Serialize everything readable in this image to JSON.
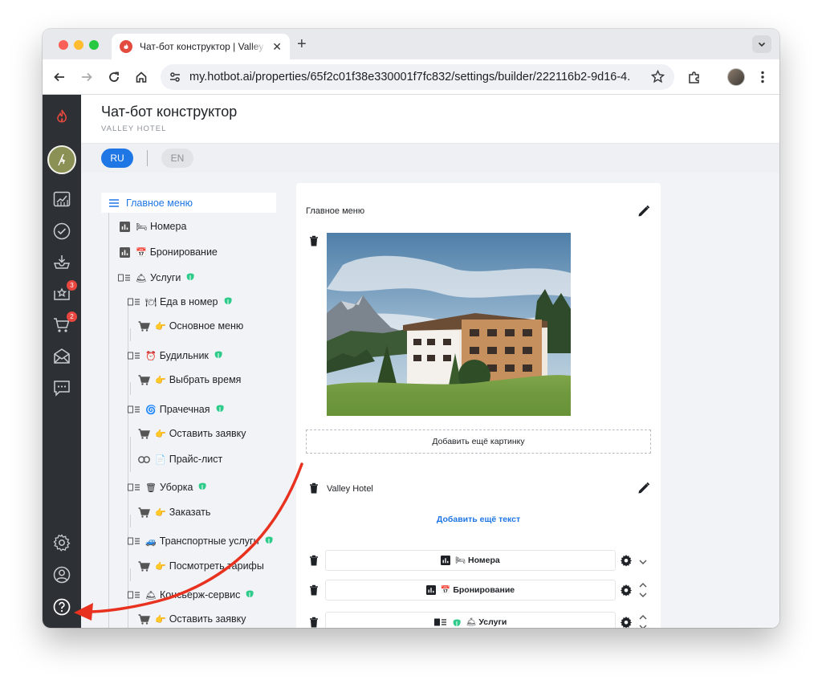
{
  "browser": {
    "tab_title": "Чат-бот конструктор | Valley Hotel",
    "url": "my.hotbot.ai/properties/65f2c01f38e330001f7fc832/settings/builder/222116b2-9d16-4..."
  },
  "sidebar": {
    "badges": {
      "reviews": "3",
      "orders": "2"
    }
  },
  "header": {
    "title": "Чат-бот конструктор",
    "subtitle": "VALLEY HOTEL"
  },
  "languages": {
    "active": "RU",
    "inactive": "EN"
  },
  "tree": {
    "root": "Главное меню",
    "items": [
      {
        "emoji": "🛏",
        "label": "Номера"
      },
      {
        "emoji": "📅",
        "label": "Бронирование"
      },
      {
        "emoji": "🛎",
        "label": "Услуги"
      },
      {
        "emoji": "🍽",
        "label": "Еда в номер"
      },
      {
        "emoji": "👉",
        "label": "Основное меню"
      },
      {
        "emoji": "⏰",
        "label": "Будильник"
      },
      {
        "emoji": "👉",
        "label": "Выбрать время"
      },
      {
        "emoji": "🌀",
        "label": "Прачечная"
      },
      {
        "emoji": "👉",
        "label": "Оставить заявку"
      },
      {
        "emoji": "📄",
        "label": "Прайс-лист"
      },
      {
        "emoji": "🗑",
        "label": "Уборка"
      },
      {
        "emoji": "👉",
        "label": "Заказать"
      },
      {
        "emoji": "🚙",
        "label": "Транспортные услуги"
      },
      {
        "emoji": "👉",
        "label": "Посмотреть тарифы"
      },
      {
        "emoji": "🛎",
        "label": "Консьерж-сервис"
      },
      {
        "emoji": "👉",
        "label": "Оставить заявку"
      }
    ]
  },
  "panel": {
    "title": "Главное меню",
    "add_image_label": "Добавить ещё картинку",
    "text_value": "Valley Hotel",
    "add_text_label": "Добавить ещё текст",
    "buttons": [
      {
        "emoji": "🛏",
        "label": "Номера"
      },
      {
        "emoji": "📅",
        "label": "Бронирование"
      },
      {
        "emoji": "🛎",
        "label": "Услуги"
      }
    ]
  },
  "colors": {
    "accent": "#1f76e5",
    "sidebar_bg": "#2d3035",
    "annotation_arrow": "#e8321f",
    "chat_fab": "#8f9a58"
  },
  "icons": {
    "sidebar": [
      "hotbot-logo-icon",
      "property-avatar",
      "analytics-icon",
      "tasks-check-icon",
      "inbox-icon",
      "reviews-star-icon",
      "cart-icon",
      "mail-broadcast-icon",
      "chat-bubble-icon",
      "settings-gear-icon",
      "user-profile-icon",
      "help-question-icon"
    ]
  }
}
